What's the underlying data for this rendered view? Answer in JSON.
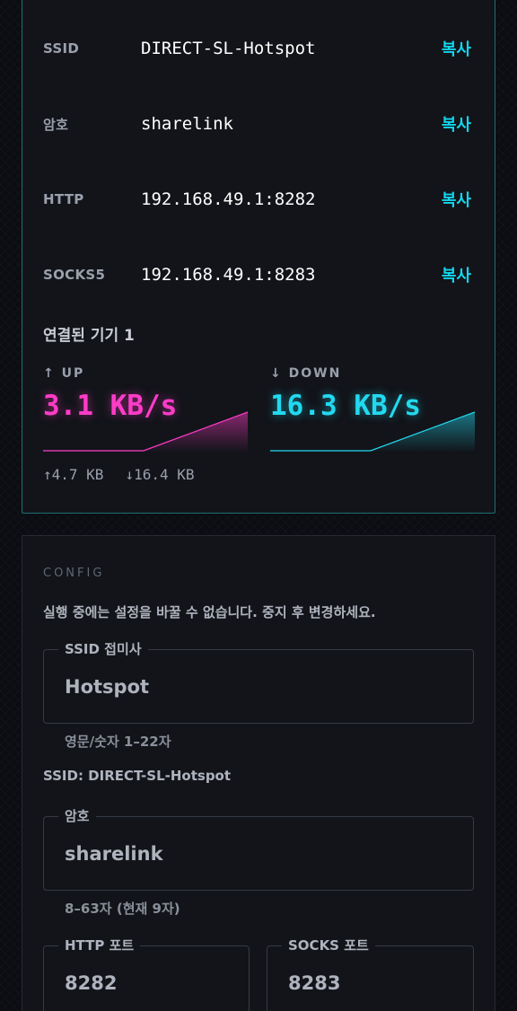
{
  "connection": {
    "rows": [
      {
        "key": "SSID",
        "value": "DIRECT-SL-Hotspot",
        "action": "복사"
      },
      {
        "key": "암호",
        "value": "sharelink",
        "action": "복사"
      },
      {
        "key": "HTTP",
        "value": "192.168.49.1:8282",
        "action": "복사"
      },
      {
        "key": "SOCKS5",
        "value": "192.168.49.1:8283",
        "action": "복사"
      }
    ],
    "devices_label": "연결된 기기 1",
    "up": {
      "label": "↑ UP",
      "value": "3.1 KB/s",
      "color": "#ff3cc8"
    },
    "down": {
      "label": "↓ DOWN",
      "value": "16.3 KB/s",
      "color": "#22d9f0"
    },
    "totals": {
      "up": "↑4.7 KB",
      "down": "↓16.4 KB"
    }
  },
  "config": {
    "section_title": "CONFIG",
    "notice": "실행 중에는 설정을 바꿀 수 없습니다. 중지 후 변경하세요.",
    "ssid_suffix": {
      "label": "SSID 접미사",
      "value": "Hotspot",
      "helper": "영문/숫자 1–22자"
    },
    "ssid_preview": "SSID: DIRECT-SL-Hotspot",
    "password": {
      "label": "암호",
      "value": "sharelink",
      "helper": "8–63자 (현재 9자)"
    },
    "http_port": {
      "label": "HTTP 포트",
      "value": "8282"
    },
    "socks_port": {
      "label": "SOCKS 포트",
      "value": "8283"
    }
  },
  "colors": {
    "accent": "#12d6ee",
    "up": "#ff3cc8",
    "down": "#22d9f0",
    "card_border": "#1f6e78"
  }
}
